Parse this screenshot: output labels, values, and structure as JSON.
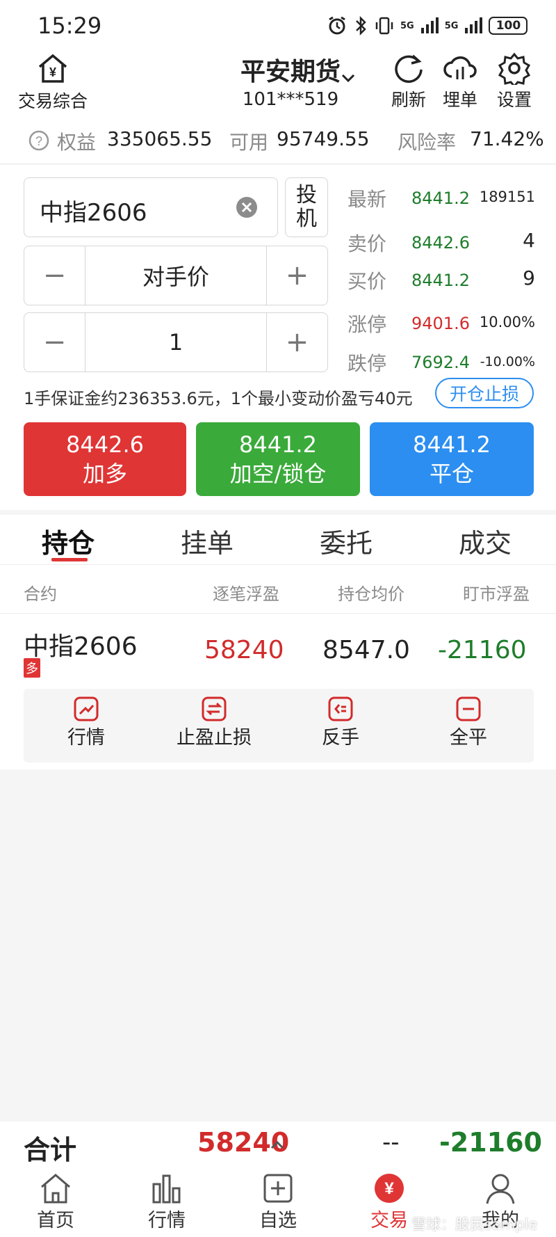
{
  "status_bar": {
    "time": "15:29",
    "net1": "5G",
    "net2": "5G",
    "battery": "100"
  },
  "header": {
    "left_label": "交易综合",
    "broker": "平安期货",
    "account": "101***519",
    "refresh_label": "刷新",
    "cloud_label": "埋单",
    "settings_label": "设置"
  },
  "summary": {
    "equity_label": "权益",
    "equity_value": "335065.55",
    "available_label": "可用",
    "available_value": "95749.55",
    "risk_label": "风险率",
    "risk_value": "71.42%"
  },
  "order": {
    "contract": "中指2606",
    "hedge_label_1": "投",
    "hedge_label_2": "机",
    "price_type": "对手价",
    "quantity": "1",
    "minus": "−",
    "plus": "+",
    "margin_note": "1手保证金约236353.6元，1个最小变动价盈亏40元",
    "stoploss_button": "开仓止损"
  },
  "quotes": {
    "latest_label": "最新",
    "latest_price": "8441.2",
    "volume": "189151",
    "ask_label": "卖价",
    "ask_price": "8442.6",
    "ask_qty": "4",
    "bid_label": "买价",
    "bid_price": "8441.2",
    "bid_qty": "9",
    "limit_up_label": "涨停",
    "limit_up_price": "9401.6",
    "limit_up_pct": "10.00%",
    "limit_down_label": "跌停",
    "limit_down_price": "7692.4",
    "limit_down_pct": "-10.00%"
  },
  "buttons": {
    "buy_price": "8442.6",
    "buy_label": "加多",
    "sell_price": "8441.2",
    "sell_label": "加空/锁仓",
    "close_price": "8441.2",
    "close_label": "平仓"
  },
  "tabs": [
    "持仓",
    "挂单",
    "委托",
    "成交"
  ],
  "columns": [
    "合约",
    "逐笔浮盈",
    "持仓均价",
    "盯市浮盈"
  ],
  "position": {
    "contract": "中指2606",
    "direction": "多",
    "trade_pnl": "58240",
    "avg_price": "8547.0",
    "mark_pnl": "-21160",
    "actions": [
      "行情",
      "止盈止损",
      "反手",
      "全平"
    ]
  },
  "total": {
    "label": "合计",
    "trade_pnl": "58240",
    "avg_price": "--",
    "mark_pnl": "-21160"
  },
  "nav": [
    "首页",
    "行情",
    "自选",
    "交易",
    "我的"
  ],
  "watermark": "雪球：股民sample",
  "colors": {
    "red": "#e03535",
    "green": "#3aaa3a",
    "blue": "#2b8ef0"
  }
}
